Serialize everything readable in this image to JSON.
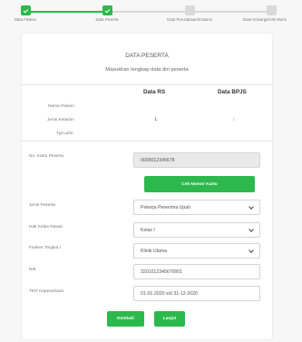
{
  "stepper": {
    "steps": [
      {
        "label": "Data Faskes",
        "state": "done"
      },
      {
        "label": "Data Peserta",
        "state": "done"
      },
      {
        "label": "Data Perusahaan/Instansi",
        "state": "pending"
      },
      {
        "label": "Data Keluarga/Ahli Waris",
        "state": "pending"
      }
    ]
  },
  "form": {
    "title": "DATA PESERTA",
    "subtitle": "Masukkan lengkap data diri peserta",
    "col_ri": "Data RS",
    "col_bpjs": "Data BPJS",
    "rows": {
      "nama": "Nama Pasien",
      "jk": "Jenis Kelamin",
      "tgl": "Tgl Lahir"
    },
    "jk_ri": "L",
    "jk_bpjs": "L",
    "no_kartu_label": "No. Kartu Peserta",
    "no_kartu_value": "0000012345678",
    "check_btn": "Cek Nomor Kartu",
    "jenis_label": "Jenis Peserta",
    "jenis_value": "Pekerja Penerima Upah",
    "kelas_label": "Hak Kelas Rawat",
    "kelas_value": "Kelas I",
    "faskes_label": "Faskes Tingkat I",
    "faskes_value": "Klinik Utama",
    "nik_label": "NIK",
    "nik_value": "3201012345670001",
    "tmt_label": "TMT Kepesertaan",
    "tmt_value": "01-01-2020 s/d 31-12-2020",
    "back_btn": "Kembali",
    "next_btn": "Lanjut"
  },
  "colors": {
    "accent": "#2db84d",
    "pending": "#d9d9d9"
  }
}
